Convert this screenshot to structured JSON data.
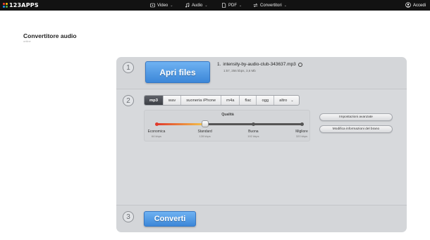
{
  "brand": {
    "logo_text": "123APPS",
    "logo_colors": [
      "#f44336",
      "#ffc107",
      "#2196f3",
      "#4caf50"
    ]
  },
  "nav": {
    "items": [
      {
        "label": "Video",
        "icon": "video-icon"
      },
      {
        "label": "Audio",
        "icon": "music-note-icon"
      },
      {
        "label": "PDF",
        "icon": "document-icon"
      },
      {
        "label": "Convertitori",
        "icon": "convert-icon"
      }
    ],
    "login_label": "Accedi"
  },
  "page": {
    "title": "Convertitore audio",
    "subtitle": "online"
  },
  "step1": {
    "number": "1",
    "open_button": "Apri files",
    "file": {
      "index": "1.",
      "name": "intensity-by-audio-club-343637.mp3",
      "meta": "1:57, 256 kbps, 3,6 Mb"
    }
  },
  "step2": {
    "number": "2",
    "formats": [
      "mp3",
      "wav",
      "suoneria iPhone",
      "m4a",
      "flac",
      "ogg",
      "altro"
    ],
    "selected_format": "mp3",
    "more_format_chevron": "⌄",
    "quality": {
      "title": "Qualità",
      "level": 0.333,
      "stops": [
        {
          "label": "Economica",
          "kbps": "64 kbps"
        },
        {
          "label": "Standard",
          "kbps": "128 kbps"
        },
        {
          "label": "Buona",
          "kbps": "192 kbps"
        },
        {
          "label": "Migliore",
          "kbps": "320 kbps"
        }
      ]
    },
    "advanced_button": "Impostazioni avanzate",
    "edit_info_button": "Modifica informazioni del brano"
  },
  "step3": {
    "number": "3",
    "convert_button": "Converti"
  },
  "colors": {
    "accent_blue": "#3c87d8",
    "topbar": "#121212",
    "panel": "#d4d6d9",
    "slider_start": "#e03a2c",
    "slider_end": "#f4c64a"
  }
}
